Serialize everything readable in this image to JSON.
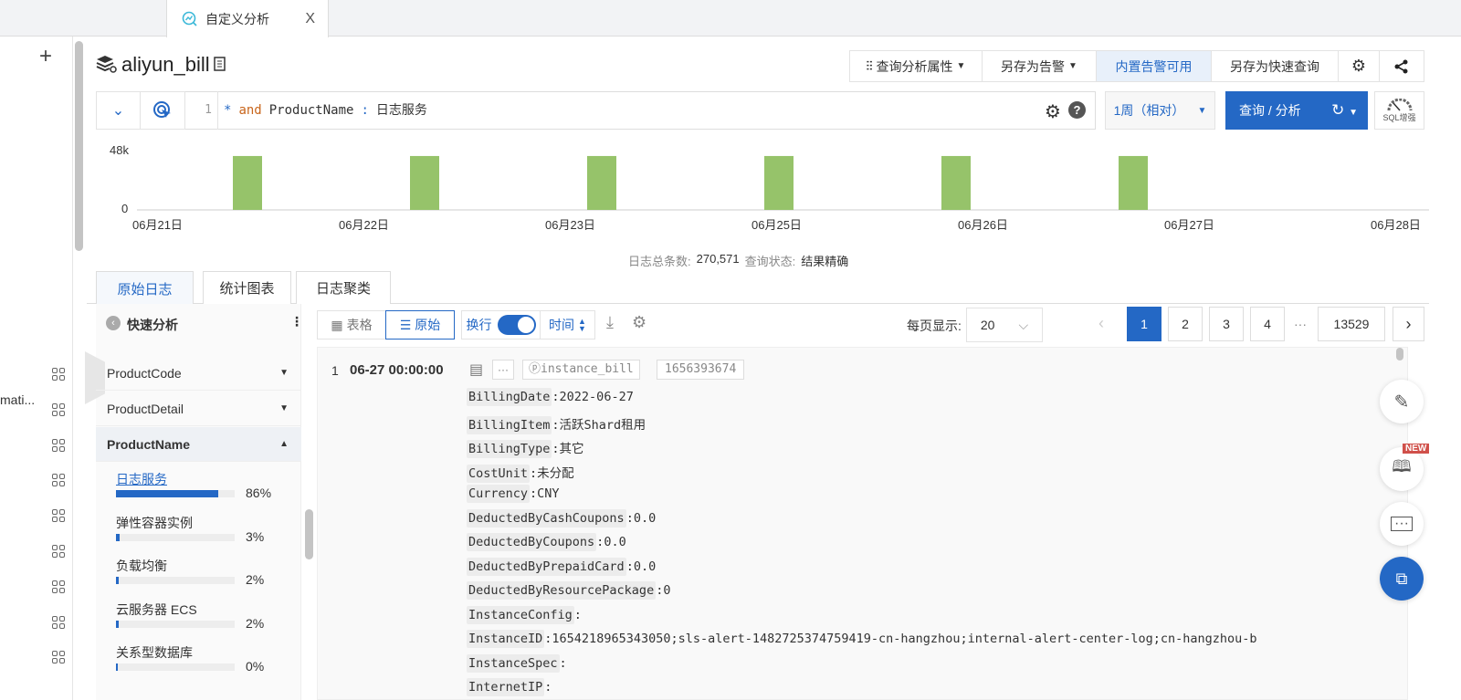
{
  "tabbar": {
    "active_tab": "自定义分析",
    "close": "X"
  },
  "rail": {
    "add": "+",
    "truncated_item": "mati..."
  },
  "header": {
    "logstore": "aliyun_bill"
  },
  "toolbar": {
    "query_props": "查询分析属性",
    "save_alert": "另存为告警",
    "builtin_alert": "内置告警可用",
    "save_quick": "另存为快速查询"
  },
  "query": {
    "line_no": "1",
    "star": "*",
    "and": "and",
    "field": "ProductName",
    "colon": ":",
    "value": "日志服务",
    "time_range": "1周（相对）",
    "search_btn": "查询 / 分析",
    "sql_label": "SQL增强"
  },
  "chart_data": {
    "type": "bar",
    "ytick_labels": [
      "48k",
      "0"
    ],
    "ylim": [
      0,
      48000
    ],
    "xtick_labels": [
      "06月21日",
      "06月22日",
      "06月23日",
      "06月25日",
      "06月26日",
      "06月27日",
      "06月28日"
    ],
    "bar_values": [
      45000,
      45000,
      45000,
      45000,
      45000,
      45000
    ],
    "bar_color": "#96c36a"
  },
  "summary": {
    "count_label": "日志总条数:",
    "count": "270,571",
    "status_label": "查询状态:",
    "status": "结果精确"
  },
  "tabs": [
    "原始日志",
    "统计图表",
    "日志聚类"
  ],
  "quick": {
    "title": "快速分析",
    "more": "⋮",
    "fields": [
      {
        "name": "ProductCode",
        "open": false
      },
      {
        "name": "ProductDetail",
        "open": false
      },
      {
        "name": "ProductName",
        "open": true
      }
    ],
    "values": [
      {
        "label": "日志服务",
        "pct": 86,
        "pct_text": "86%"
      },
      {
        "label": "弹性容器实例",
        "pct": 3,
        "pct_text": "3%"
      },
      {
        "label": "负载均衡",
        "pct": 2,
        "pct_text": "2%"
      },
      {
        "label": "云服务器 ECS",
        "pct": 2,
        "pct_text": "2%"
      },
      {
        "label": "关系型数据库",
        "pct": 0,
        "pct_text": "0%"
      }
    ]
  },
  "view": {
    "table": "表格",
    "raw": "原始",
    "wrap": "换行",
    "time": "时间",
    "per_page_label": "每页显示:",
    "per_page": "20",
    "pages": [
      "1",
      "2",
      "3",
      "4"
    ],
    "ellipsis": "···",
    "last_page": "13529"
  },
  "log": {
    "index": "1",
    "time": "06-27 00:00:00",
    "source": "instance_bill",
    "tag": "1656393674",
    "fields": [
      {
        "k": "BillingDate",
        "v": "2022-06-27"
      },
      {
        "k": "BillingItem",
        "v": "活跃Shard租用"
      },
      {
        "k": "BillingType",
        "v": "其它"
      },
      {
        "k": "CostUnit",
        "v": "未分配"
      },
      {
        "k": "Currency",
        "v": "CNY"
      },
      {
        "k": "DeductedByCashCoupons",
        "v": "0.0"
      },
      {
        "k": "DeductedByCoupons",
        "v": "0.0"
      },
      {
        "k": "DeductedByPrepaidCard",
        "v": "0.0"
      },
      {
        "k": "DeductedByResourcePackage",
        "v": "0"
      },
      {
        "k": "InstanceConfig",
        "v": ""
      },
      {
        "k": "InstanceID",
        "v": "1654218965343050;sls-alert-1482725374759419-cn-hangzhou;internal-alert-center-log;cn-hangzhou-b"
      },
      {
        "k": "InstanceSpec",
        "v": ""
      },
      {
        "k": "InternetIP",
        "v": ""
      }
    ]
  },
  "fab": {
    "new_badge": "NEW"
  }
}
